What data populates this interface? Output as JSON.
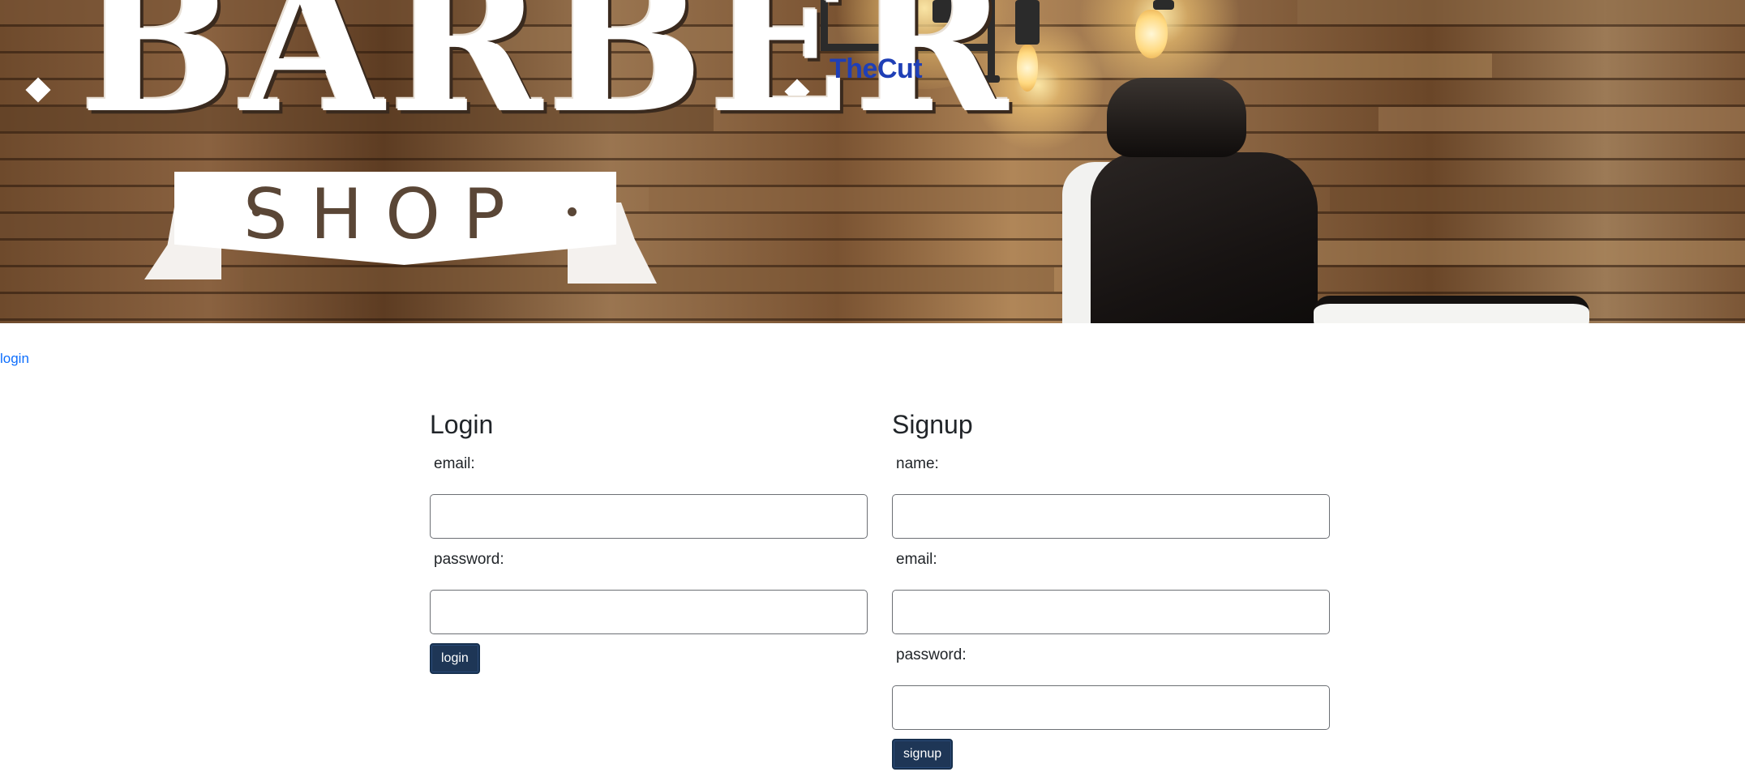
{
  "header": {
    "brand": "TheCut",
    "banner_logo_top": "BARBER",
    "banner_logo_bottom": "SHOP"
  },
  "nav": {
    "login_link": "login"
  },
  "login_form": {
    "title": "Login",
    "email_label": "email:",
    "password_label": "password:",
    "email_value": "",
    "password_value": "",
    "submit_label": "login"
  },
  "signup_form": {
    "title": "Signup",
    "name_label": "name:",
    "email_label": "email:",
    "password_label": "password:",
    "name_value": "",
    "email_value": "",
    "password_value": "",
    "submit_label": "signup"
  },
  "colors": {
    "brand_link": "#1f3fb6",
    "nav_link": "#0d6efd",
    "button_bg": "#1e3656",
    "text": "#212529"
  }
}
